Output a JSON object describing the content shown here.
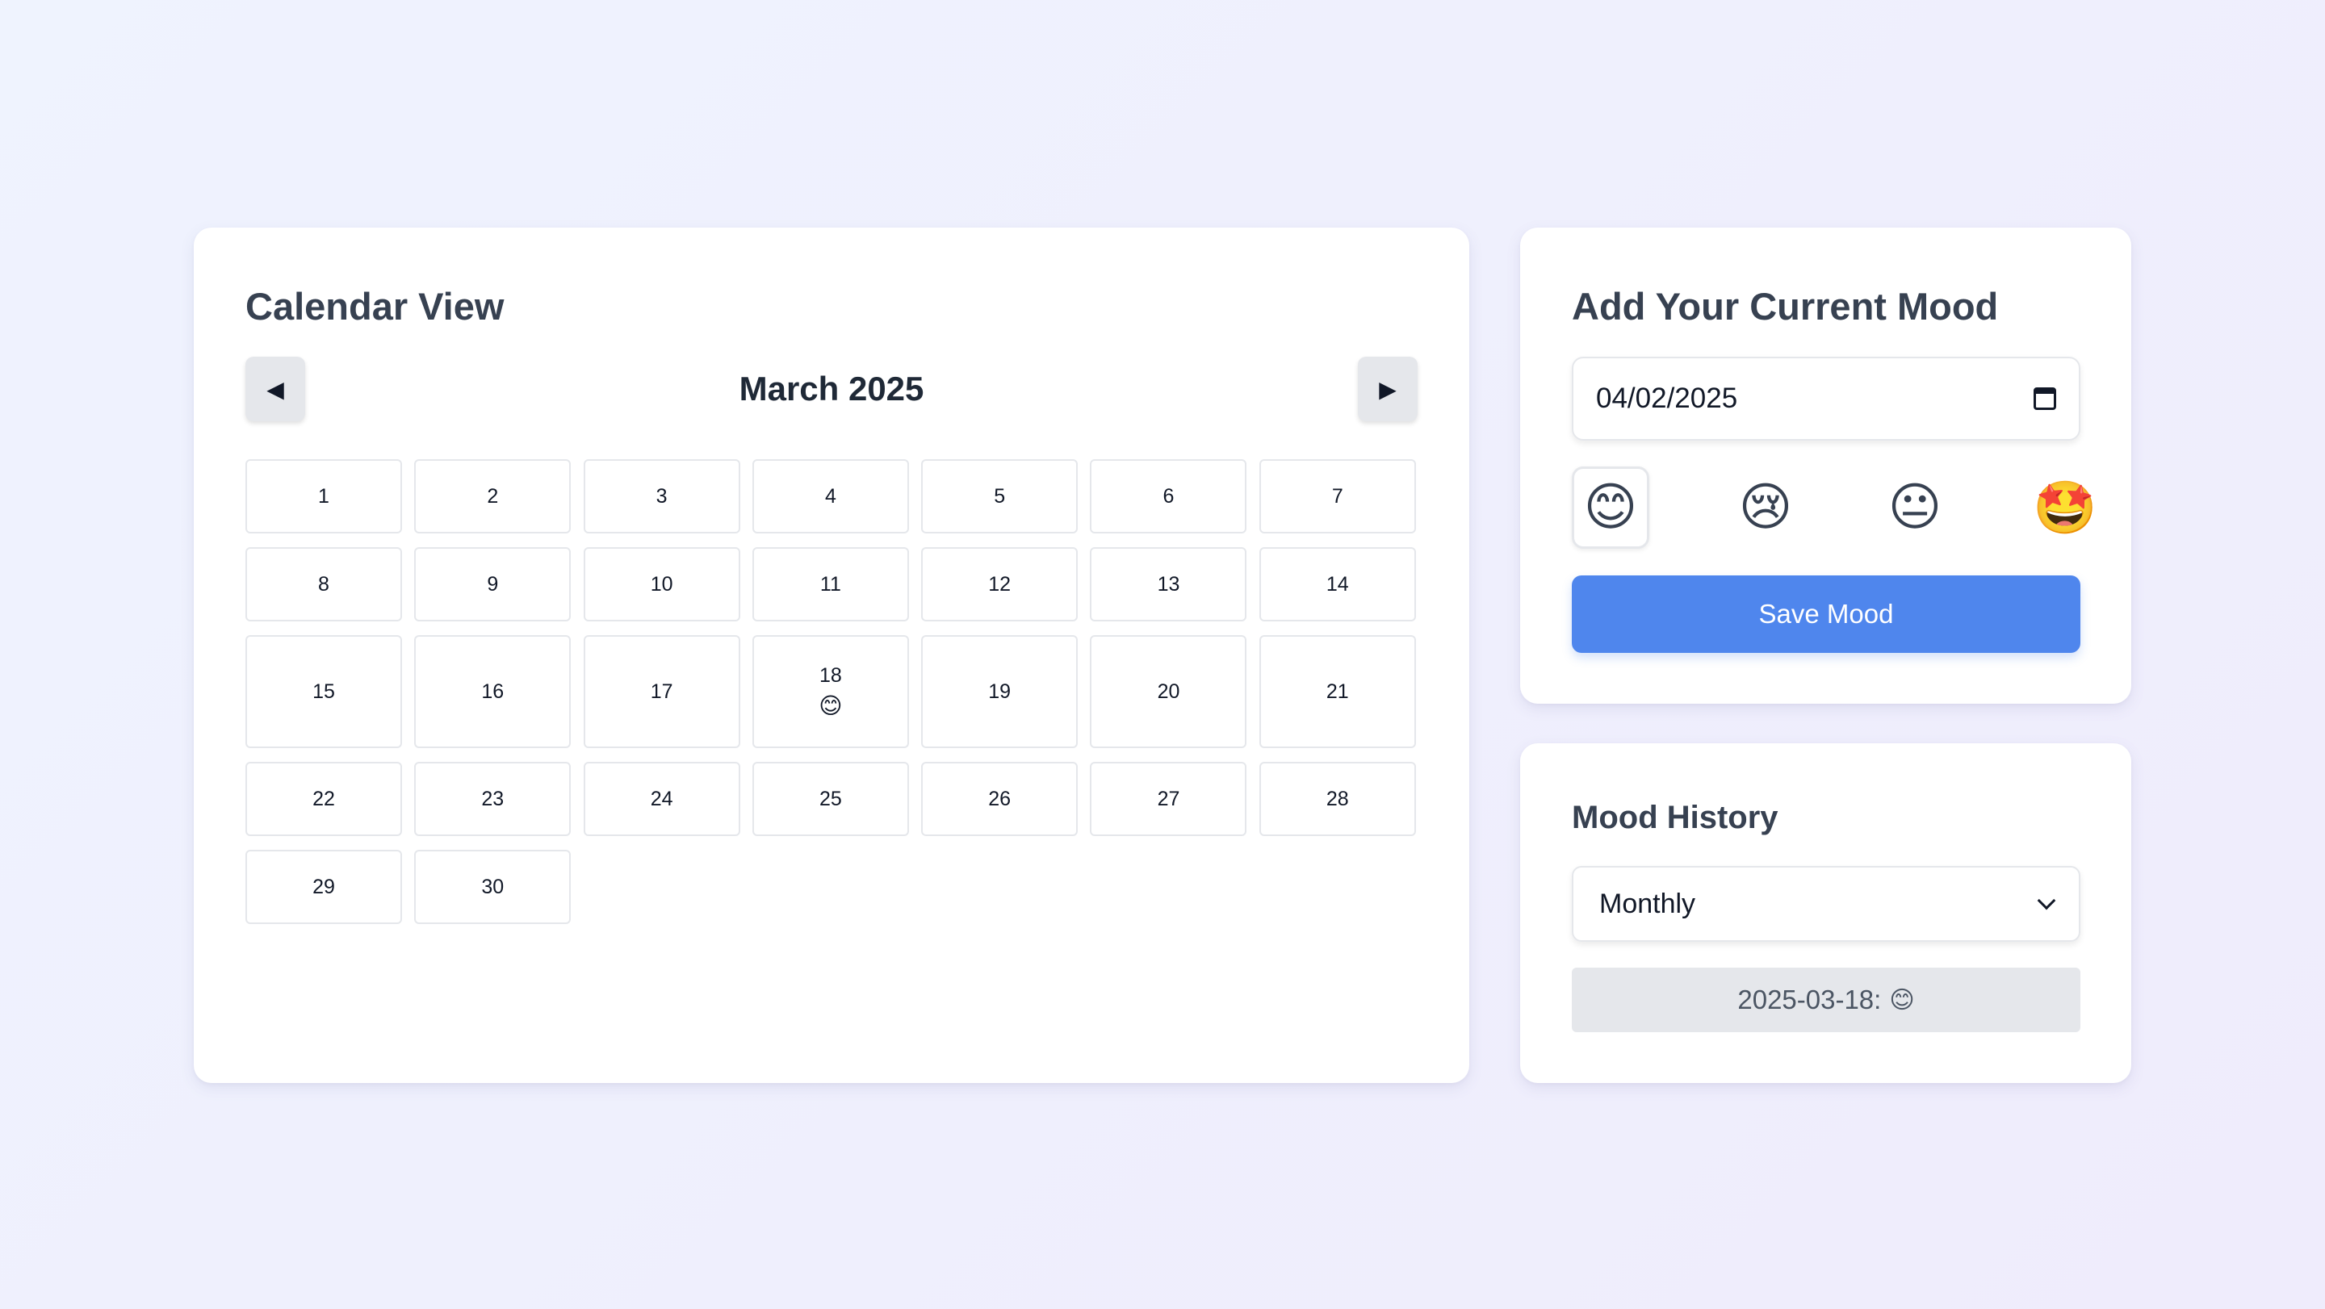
{
  "calendar": {
    "title": "Calendar View",
    "month_label": "March 2025",
    "prev_icon": "◀",
    "next_icon": "▶",
    "days": [
      {
        "day": "1",
        "mood": ""
      },
      {
        "day": "2",
        "mood": ""
      },
      {
        "day": "3",
        "mood": ""
      },
      {
        "day": "4",
        "mood": ""
      },
      {
        "day": "5",
        "mood": ""
      },
      {
        "day": "6",
        "mood": ""
      },
      {
        "day": "7",
        "mood": ""
      },
      {
        "day": "8",
        "mood": ""
      },
      {
        "day": "9",
        "mood": ""
      },
      {
        "day": "10",
        "mood": ""
      },
      {
        "day": "11",
        "mood": ""
      },
      {
        "day": "12",
        "mood": ""
      },
      {
        "day": "13",
        "mood": ""
      },
      {
        "day": "14",
        "mood": ""
      },
      {
        "day": "15",
        "mood": ""
      },
      {
        "day": "16",
        "mood": ""
      },
      {
        "day": "17",
        "mood": ""
      },
      {
        "day": "18",
        "mood": "😊"
      },
      {
        "day": "19",
        "mood": ""
      },
      {
        "day": "20",
        "mood": ""
      },
      {
        "day": "21",
        "mood": ""
      },
      {
        "day": "22",
        "mood": ""
      },
      {
        "day": "23",
        "mood": ""
      },
      {
        "day": "24",
        "mood": ""
      },
      {
        "day": "25",
        "mood": ""
      },
      {
        "day": "26",
        "mood": ""
      },
      {
        "day": "27",
        "mood": ""
      },
      {
        "day": "28",
        "mood": ""
      },
      {
        "day": "29",
        "mood": ""
      },
      {
        "day": "30",
        "mood": ""
      }
    ]
  },
  "add_mood": {
    "title": "Add Your Current Mood",
    "date_value": "04/02/2025",
    "moods": [
      {
        "emoji": "😊",
        "name": "happy",
        "selected": true
      },
      {
        "emoji": "😢",
        "name": "sad",
        "selected": false
      },
      {
        "emoji": "😐",
        "name": "neutral",
        "selected": false
      },
      {
        "emoji": "🤩",
        "name": "excited",
        "selected": false
      }
    ],
    "save_label": "Save Mood"
  },
  "history": {
    "title": "Mood History",
    "period_value": "Monthly",
    "entries": [
      {
        "date": "2025-03-18:",
        "mood": "😊"
      }
    ]
  },
  "colors": {
    "accent": "#4f86ed",
    "card_bg": "#ffffff",
    "border": "#e5e7eb"
  }
}
